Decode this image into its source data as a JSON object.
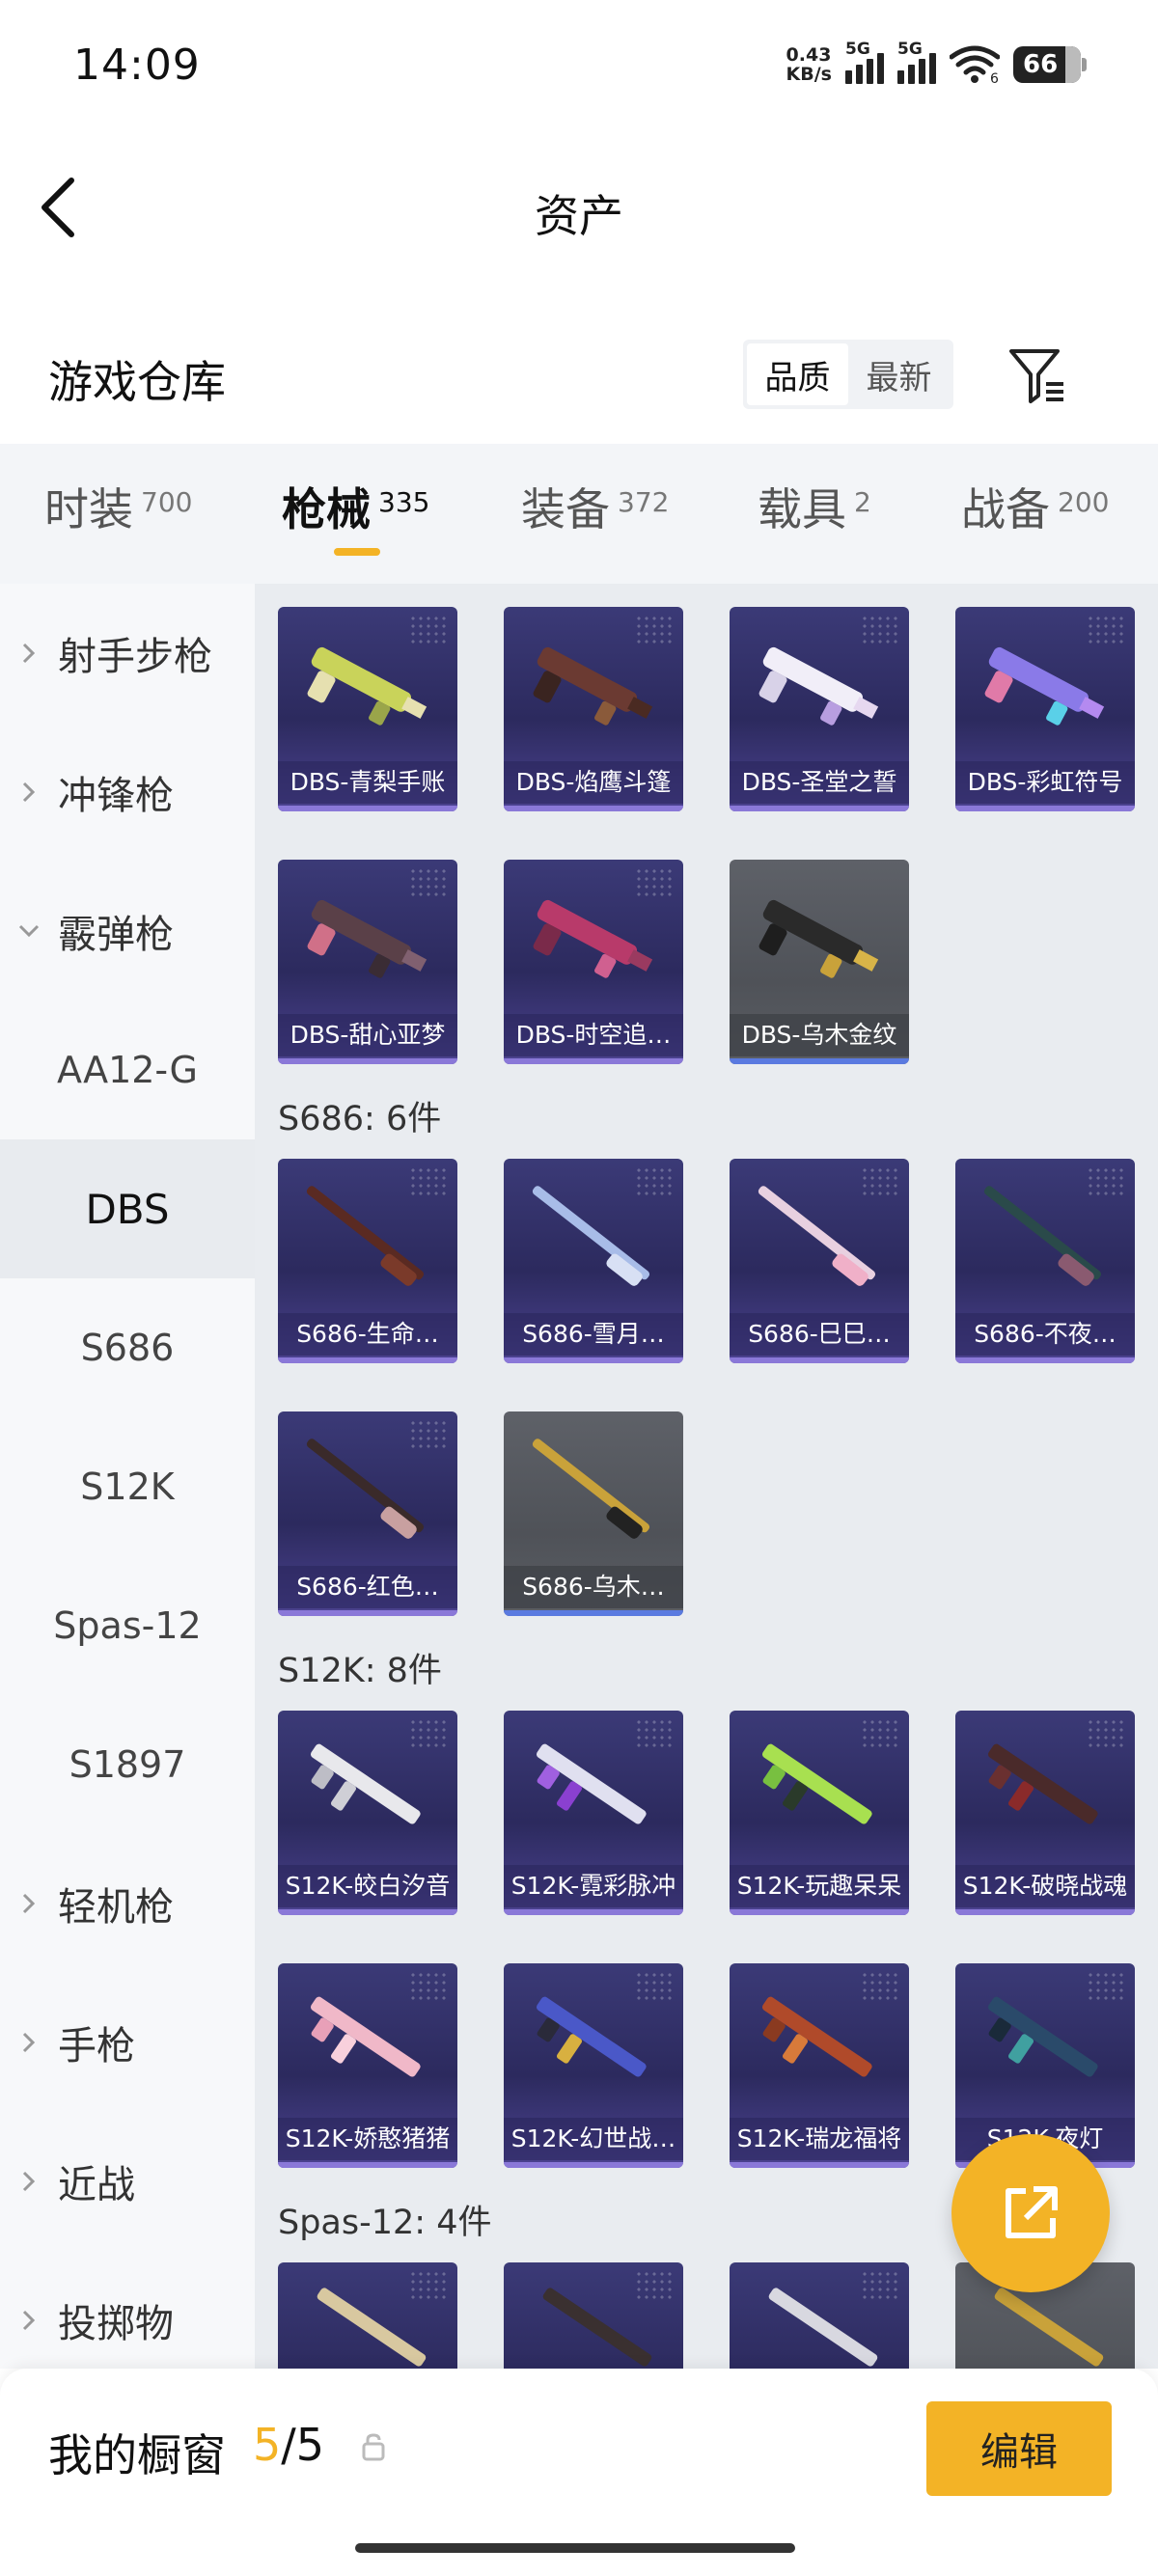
{
  "status": {
    "time": "14:09",
    "speed_value": "0.43",
    "speed_unit": "KB/s",
    "sig1": "5G",
    "sig2": "5G",
    "wifi_badge": "6",
    "battery": "66"
  },
  "header": {
    "title": "资产"
  },
  "repo": {
    "title": "游戏仓库",
    "sort_quality": "品质",
    "sort_newest": "最新"
  },
  "tabs": [
    {
      "label": "时装",
      "count": "700"
    },
    {
      "label": "枪械",
      "count": "335"
    },
    {
      "label": "装备",
      "count": "372"
    },
    {
      "label": "载具",
      "count": "2"
    },
    {
      "label": "战备",
      "count": "200"
    }
  ],
  "sidebar": [
    {
      "label": "射手步枪"
    },
    {
      "label": "冲锋枪"
    },
    {
      "label": "霰弹枪"
    },
    {
      "label": "AA12-G"
    },
    {
      "label": "DBS"
    },
    {
      "label": "S686"
    },
    {
      "label": "S12K"
    },
    {
      "label": "Spas-12"
    },
    {
      "label": "S1897"
    },
    {
      "label": "轻机枪"
    },
    {
      "label": "手枪"
    },
    {
      "label": "近战"
    },
    {
      "label": "投掷物"
    }
  ],
  "sections": {
    "dbs": [
      {
        "label": "DBS-青梨手账"
      },
      {
        "label": "DBS-焰鹰斗篷"
      },
      {
        "label": "DBS-圣堂之誓"
      },
      {
        "label": "DBS-彩虹符号"
      },
      {
        "label": "DBS-甜心亚梦"
      },
      {
        "label": "DBS-时空追…"
      },
      {
        "label": "DBS-乌木金纹"
      }
    ],
    "s686_title": "S686: 6件",
    "s686": [
      {
        "label": "S686-生命…"
      },
      {
        "label": "S686-雪月…"
      },
      {
        "label": "S686-巳巳…"
      },
      {
        "label": "S686-不夜…"
      },
      {
        "label": "S686-红色…"
      },
      {
        "label": "S686-乌木…"
      }
    ],
    "s12k_title": "S12K: 8件",
    "s12k": [
      {
        "label": "S12K-皎白汐音"
      },
      {
        "label": "S12K-霓彩脉冲"
      },
      {
        "label": "S12K-玩趣呆呆"
      },
      {
        "label": "S12K-破晓战魂"
      },
      {
        "label": "S12K-娇憨猪猪"
      },
      {
        "label": "S12K-幻世战…"
      },
      {
        "label": "S12K-瑞龙福将"
      },
      {
        "label": "S12K-夜灯"
      }
    ],
    "spas_title": "Spas-12: 4件"
  },
  "bottom": {
    "showcase_label": "我的橱窗",
    "showcase_current": "5",
    "showcase_sep_total": "/5",
    "edit_label": "编辑"
  }
}
